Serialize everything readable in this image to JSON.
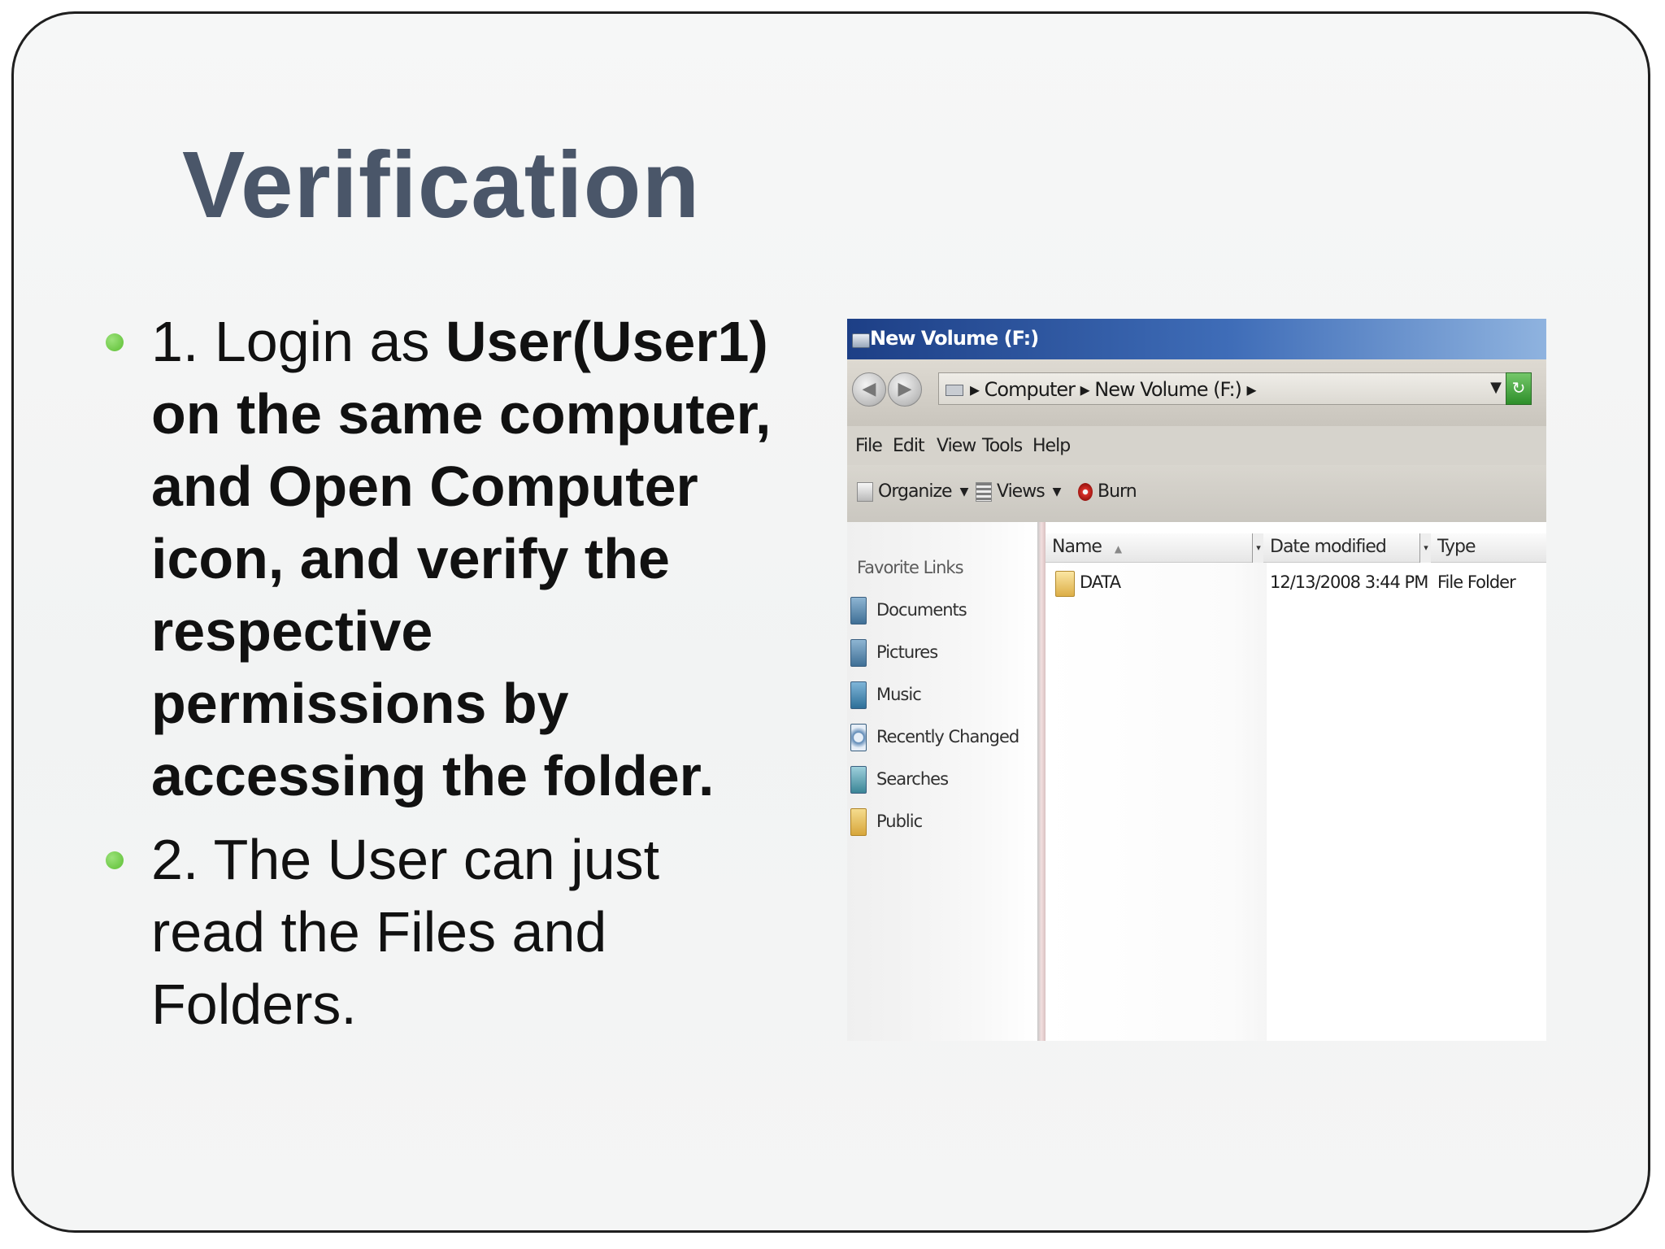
{
  "slide": {
    "title": "Verification",
    "bullets": [
      {
        "prefix": "1. Login as ",
        "bold": "User(User1) on the same computer, and Open Computer icon, and verify the respective permissions by accessing the folder."
      },
      {
        "prefix": "2. The User can just read the Files and Folders.",
        "bold": ""
      }
    ]
  },
  "explorer": {
    "window_title": "New Volume (F:)",
    "address": {
      "crumbs": "▸ Computer ▸ New Volume (F:) ▸",
      "dropdown": "▼",
      "refresh": "↻"
    },
    "nav": {
      "back": "◀",
      "forward": "▶"
    },
    "menu": [
      "File",
      "Edit",
      "View",
      "Tools",
      "Help"
    ],
    "toolbar": {
      "organize": "Organize",
      "views": "Views",
      "burn": "Burn",
      "caret": "▼"
    },
    "favorites_heading": "Favorite Links",
    "favorites": [
      {
        "label": "Documents",
        "icon": "documents-icon"
      },
      {
        "label": "Pictures",
        "icon": "pictures-icon"
      },
      {
        "label": "Music",
        "icon": "music-icon"
      },
      {
        "label": "Recently Changed",
        "icon": "recently-changed-icon"
      },
      {
        "label": "Searches",
        "icon": "searches-icon"
      },
      {
        "label": "Public",
        "icon": "public-folder-icon"
      }
    ],
    "columns": {
      "name": "Name",
      "sort_arrow": "▲",
      "date": "Date modified",
      "type": "Type",
      "sep": "▾"
    },
    "files": [
      {
        "name": "DATA",
        "date_modified": "12/13/2008 3:44 PM",
        "type": "File Folder"
      }
    ]
  }
}
